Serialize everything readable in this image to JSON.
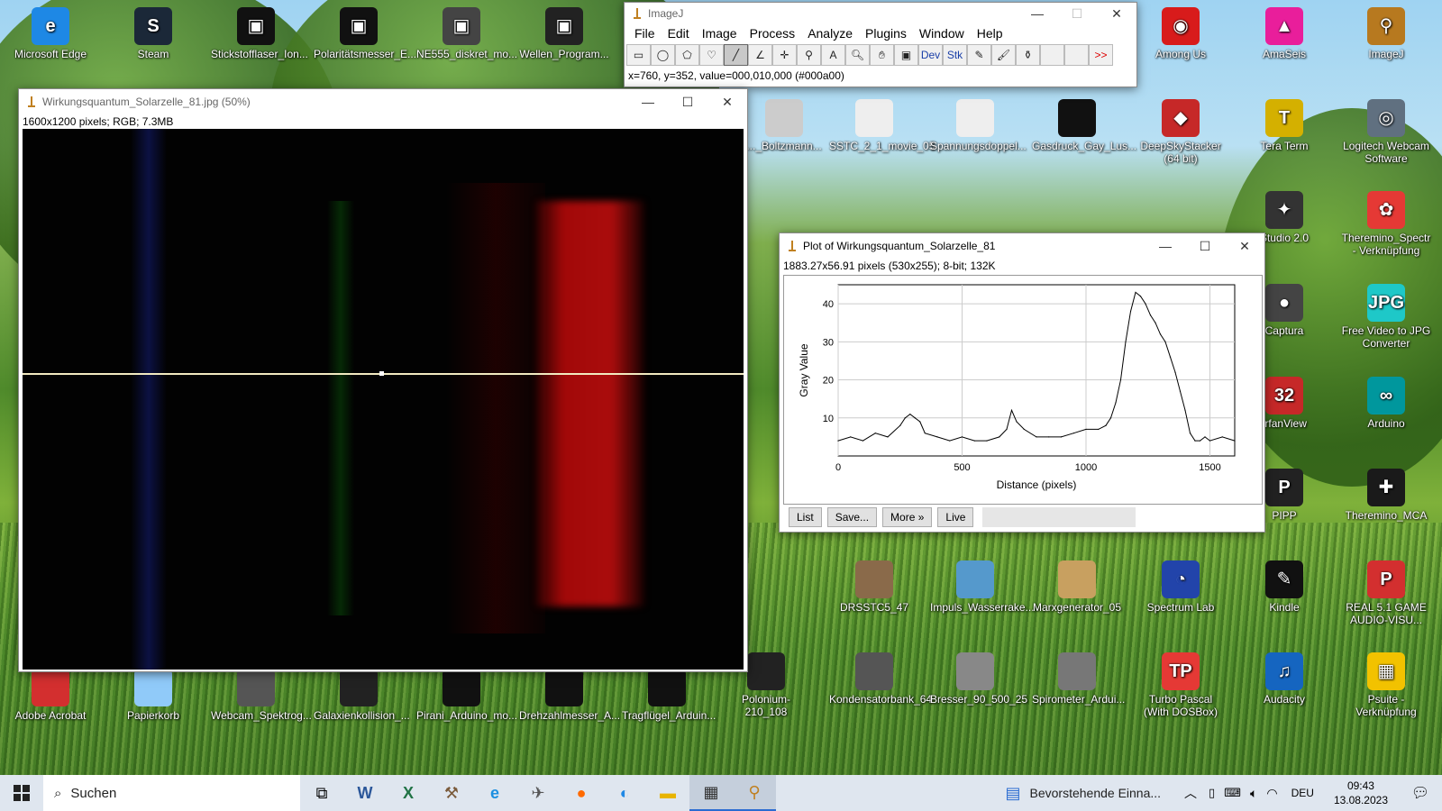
{
  "desktop_icons_left": [
    {
      "label": "Microsoft Edge",
      "color": "#1e88e5",
      "glyph": "e"
    },
    {
      "label": "Steam",
      "color": "#1b2838",
      "glyph": "S"
    },
    {
      "label": "Stickstofflaser_Ion...",
      "color": "#111111",
      "glyph": "▣"
    },
    {
      "label": "Polaritätsmesser_E...",
      "color": "#111111",
      "glyph": "▣"
    },
    {
      "label": "NE555_diskret_mo...",
      "color": "#444444",
      "glyph": "▣"
    },
    {
      "label": "Wellen_Program...",
      "color": "#222222",
      "glyph": "▣"
    }
  ],
  "desktop_icons_right": [
    {
      "label": "Among Us",
      "color": "#d81b1b",
      "glyph": "◉"
    },
    {
      "label": "AmaSeis",
      "color": "#e91e9b",
      "glyph": "▲"
    },
    {
      "label": "ImageJ",
      "color": "#b7791f",
      "glyph": "⚲"
    },
    {
      "label": "DeepSkyStacker (64 bit)",
      "color": "#c62828",
      "glyph": "◆"
    },
    {
      "label": "Tera Term",
      "color": "#d4b000",
      "glyph": "T"
    },
    {
      "label": "Logitech Webcam Software",
      "color": "#607080",
      "glyph": "◎"
    },
    {
      "label": "Studio 2.0",
      "color": "#333333",
      "glyph": "✦"
    },
    {
      "label": "Theremino_Spectr - Verknüpfung",
      "color": "#e53935",
      "glyph": "✿"
    },
    {
      "label": "Captura",
      "color": "#444444",
      "glyph": "●"
    },
    {
      "label": "Free Video to JPG Converter",
      "color": "#1ec8c8",
      "glyph": "JPG"
    },
    {
      "label": "IrfanView",
      "color": "#c62828",
      "glyph": "32"
    },
    {
      "label": "Arduino",
      "color": "#00979d",
      "glyph": "∞"
    },
    {
      "label": "PIPP",
      "color": "#222222",
      "glyph": "P"
    },
    {
      "label": "Theremino_MCA",
      "color": "#1a1a1a",
      "glyph": "✚"
    },
    {
      "label": "Spectrum Lab",
      "color": "#2244aa",
      "glyph": "◔"
    },
    {
      "label": "Kindle",
      "color": "#111111",
      "glyph": "✎"
    },
    {
      "label": "REAL 5.1 GAME AUDIO-VISU...",
      "color": "#d32f2f",
      "glyph": "P"
    },
    {
      "label": "Turbo Pascal (With DOSBox)",
      "color": "#e53935",
      "glyph": "TP"
    },
    {
      "label": "Audacity",
      "color": "#1565c0",
      "glyph": "♫"
    },
    {
      "label": "Psuite - Verknüpfung",
      "color": "#f2c200",
      "glyph": "▦"
    }
  ],
  "desktop_icons_middle": [
    {
      "label": "..._Boltzmann...",
      "color": "#cccccc"
    },
    {
      "label": "SSTC_2_1_movie_05",
      "color": "#eeeeee"
    },
    {
      "label": "Spannungsdoppel...",
      "color": "#eeeeee"
    },
    {
      "label": "Gasdruck_Gay_Lus...",
      "color": "#111111"
    },
    {
      "label": "DRSSTC5_47",
      "color": "#8a6a4a"
    },
    {
      "label": "Impuls_Wasserrake...",
      "color": "#5599cc"
    },
    {
      "label": "Marxgenerator_05",
      "color": "#c8a060"
    },
    {
      "label": "Polonium-210_108",
      "color": "#222222"
    },
    {
      "label": "Kondensatorbank_64",
      "color": "#555555"
    },
    {
      "label": "Bresser_90_500_25",
      "color": "#888888"
    },
    {
      "label": "Spirometer_Ardui...",
      "color": "#777777"
    }
  ],
  "desktop_icons_bottom": [
    {
      "label": "Adobe Acrobat",
      "color": "#d32f2f"
    },
    {
      "label": "Papierkorb",
      "color": "#90caf9"
    },
    {
      "label": "Webcam_Spektrog...",
      "color": "#555555"
    },
    {
      "label": "Galaxienkollision_...",
      "color": "#222222"
    },
    {
      "label": "Pirani_Arduino_mo...",
      "color": "#111111"
    },
    {
      "label": "Drehzahlmesser_A...",
      "color": "#111111"
    },
    {
      "label": "Tragflügel_Arduin...",
      "color": "#111111"
    }
  ],
  "imagej": {
    "title": "ImageJ",
    "menus": [
      "File",
      "Edit",
      "Image",
      "Process",
      "Analyze",
      "Plugins",
      "Window",
      "Help"
    ],
    "tools": [
      "rectangle-tool",
      "oval-tool",
      "polygon-tool",
      "freehand-tool",
      "line-tool",
      "angle-tool",
      "point-tool",
      "wand-tool",
      "text-tool",
      "magnifier-tool",
      "scroll-tool",
      "color-picker-tool",
      "Dev",
      "Stk",
      "pencil-tool",
      "brush-tool",
      "flood-fill-tool",
      "blank1",
      "blank2",
      ">>"
    ],
    "status": "x=760, y=352, value=000,010,000 (#000a00)"
  },
  "image_window": {
    "title": "Wirkungsquantum_Solarzelle_81.jpg (50%)",
    "info": "1600x1200 pixels; RGB; 7.3MB"
  },
  "plot_window": {
    "title": "Plot of Wirkungsquantum_Solarzelle_81",
    "info": "1883.27x56.91 pixels (530x255); 8-bit; 132K",
    "buttons": [
      "List",
      "Save...",
      "More »",
      "Live"
    ]
  },
  "chart_data": {
    "type": "line",
    "title": "",
    "xlabel": "Distance (pixels)",
    "ylabel": "Gray Value",
    "xlim": [
      0,
      1600
    ],
    "ylim": [
      0,
      45
    ],
    "xticks": [
      0,
      500,
      1000,
      1500
    ],
    "yticks": [
      10,
      20,
      30,
      40
    ],
    "grid": true,
    "series": [
      {
        "x": [
          0,
          50,
          100,
          150,
          200,
          250,
          270,
          290,
          310,
          330,
          350,
          400,
          450,
          500,
          550,
          600,
          650,
          680,
          700,
          720,
          750,
          800,
          850,
          900,
          950,
          1000,
          1050,
          1080,
          1100,
          1120,
          1140,
          1160,
          1180,
          1200,
          1220,
          1240,
          1260,
          1280,
          1300,
          1320,
          1340,
          1360,
          1380,
          1400,
          1420,
          1440,
          1460,
          1480,
          1500,
          1550,
          1600
        ],
        "y": [
          4,
          5,
          4,
          6,
          5,
          8,
          10,
          11,
          10,
          9,
          6,
          5,
          4,
          5,
          4,
          4,
          5,
          7,
          12,
          9,
          7,
          5,
          5,
          5,
          6,
          7,
          7,
          8,
          10,
          14,
          20,
          30,
          38,
          43,
          42,
          40,
          37,
          35,
          32,
          30,
          26,
          22,
          17,
          12,
          6,
          4,
          4,
          5,
          4,
          5,
          4
        ]
      }
    ]
  },
  "taskbar": {
    "search_placeholder": "Suchen",
    "notification": "Bevorstehende Einna...",
    "language": "DEU",
    "time": "09:43",
    "date": "13.08.2023"
  }
}
